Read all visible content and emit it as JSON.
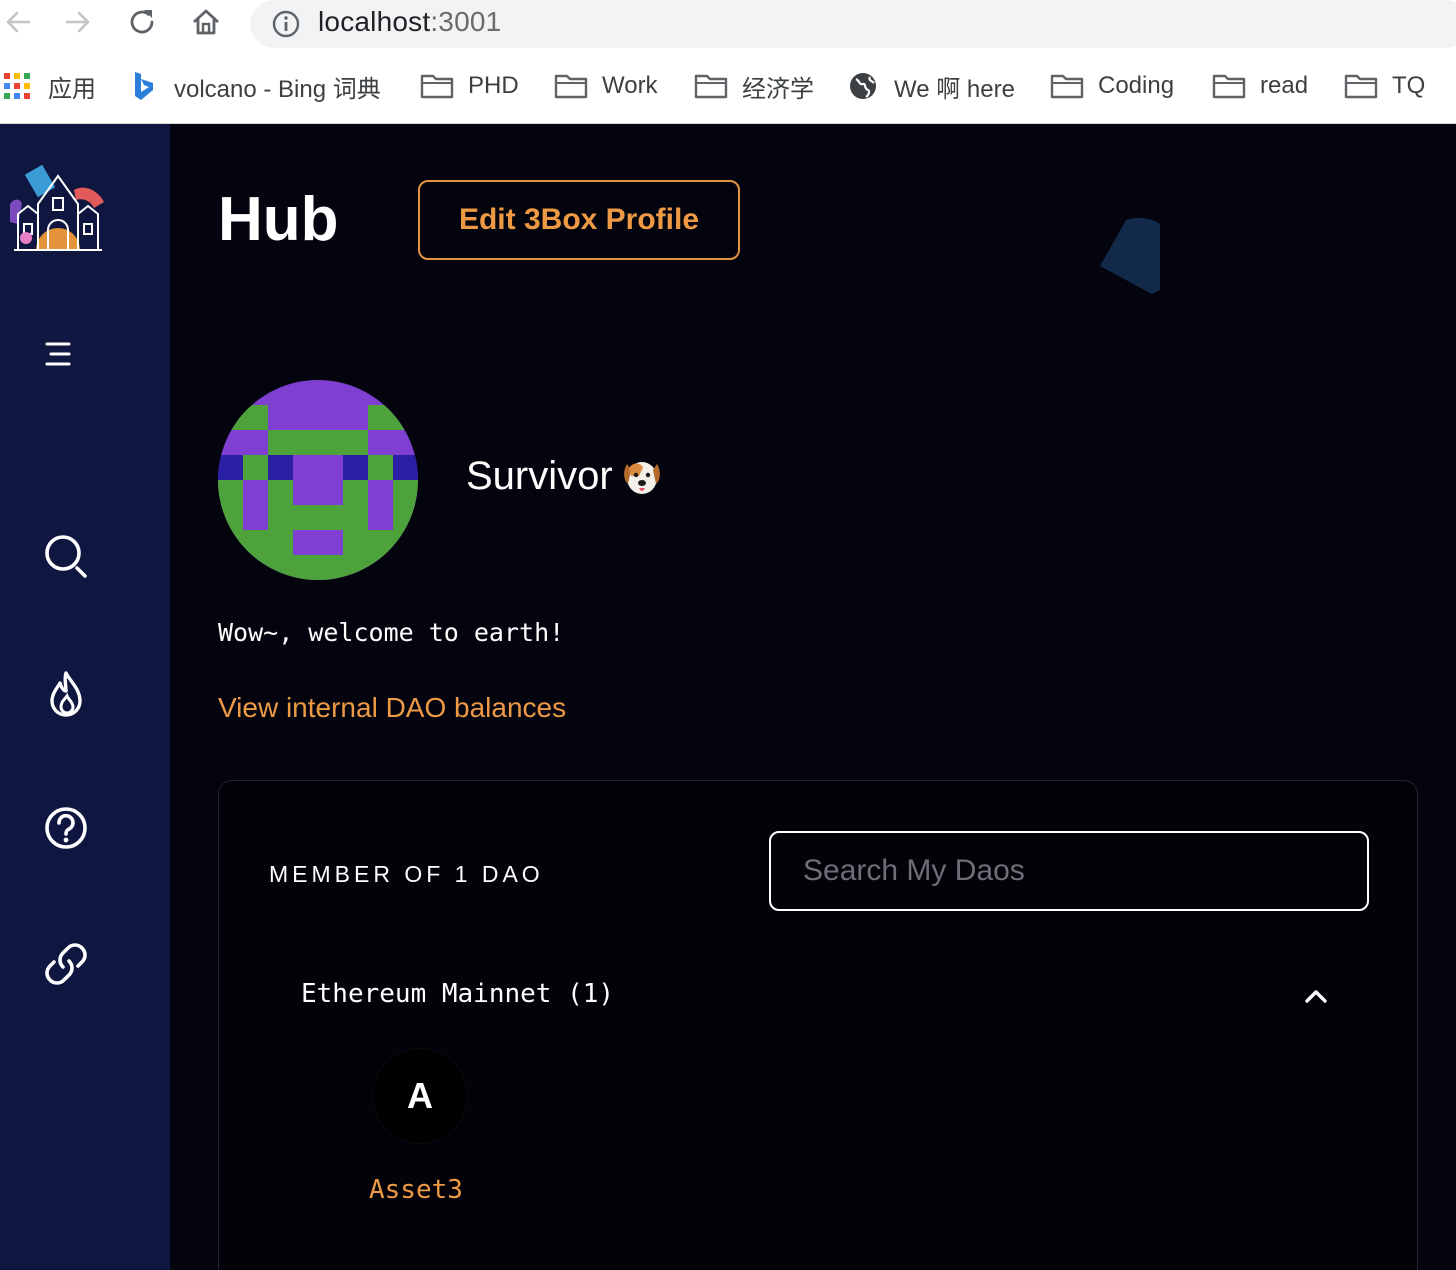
{
  "browser": {
    "url_host": "localhost",
    "url_port": ":3001",
    "bookmarks": [
      {
        "label": "应用",
        "icon": "apps-grid-icon"
      },
      {
        "label": "volcano - Bing 词典",
        "icon": "bing-icon"
      },
      {
        "label": "PHD",
        "icon": "folder-icon"
      },
      {
        "label": "Work",
        "icon": "folder-icon"
      },
      {
        "label": "经济学",
        "icon": "folder-icon"
      },
      {
        "label": "We 啊 here",
        "icon": "globe-icon"
      },
      {
        "label": "Coding",
        "icon": "folder-icon"
      },
      {
        "label": "read",
        "icon": "folder-icon"
      },
      {
        "label": "TQ",
        "icon": "folder-icon"
      }
    ]
  },
  "sidebar": {
    "items": [
      {
        "icon": "menu-icon"
      },
      {
        "icon": "search-icon"
      },
      {
        "icon": "flame-icon"
      },
      {
        "icon": "help-icon"
      },
      {
        "icon": "link-icon"
      }
    ]
  },
  "header": {
    "title": "Hub",
    "edit_button": "Edit 3Box Profile"
  },
  "profile": {
    "name": "Survivor",
    "emoji": "dog-face-icon",
    "bio": "Wow~, welcome to earth!",
    "balances_link": "View internal DAO balances"
  },
  "daos": {
    "member_of": "MEMBER OF 1 DAO",
    "search_placeholder": "Search My Daos",
    "network_title": "Ethereum Mainnet (1)",
    "items": [
      {
        "initial": "A",
        "name": "Asset3"
      }
    ]
  },
  "colors": {
    "accent": "#ee9a45",
    "sidebar": "#0f1640",
    "background": "#04040f"
  }
}
